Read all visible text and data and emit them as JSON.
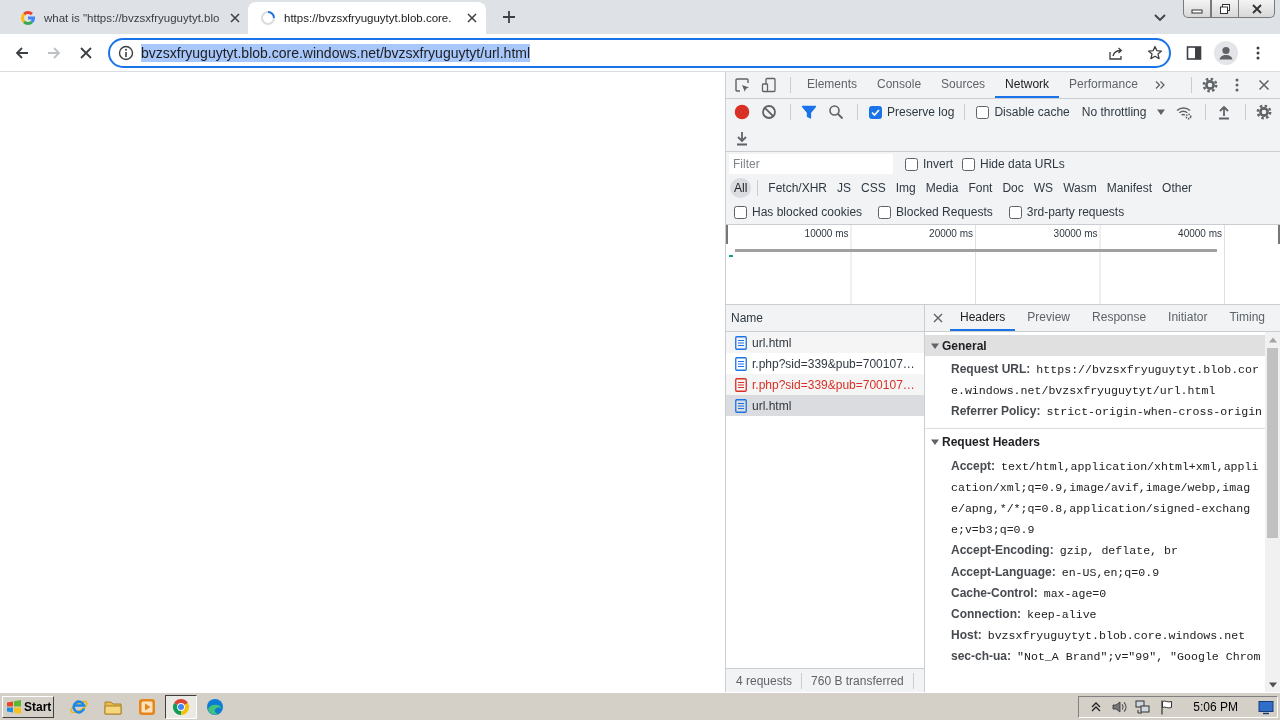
{
  "browser_tabs": [
    {
      "title": "what is \"https://bvzsxfryuguytyt.blo",
      "selected": false,
      "loading": false
    },
    {
      "title": "https://bvzsxfryuguytyt.blob.core.",
      "selected": true,
      "loading": true
    }
  ],
  "navigation": {
    "forward_enabled": false,
    "loading": true
  },
  "address_bar": {
    "url": "bvzsxfryuguytyt.blob.core.windows.net/bvzsxfryuguytyt/url.html",
    "highlighted": true
  },
  "devtools": {
    "tabs": [
      {
        "label": "Elements",
        "selected": false
      },
      {
        "label": "Console",
        "selected": false
      },
      {
        "label": "Sources",
        "selected": false
      },
      {
        "label": "Network",
        "selected": true
      },
      {
        "label": "Performance",
        "selected": false
      }
    ],
    "recording": true,
    "filter_active": true,
    "toolbar_checkboxes": [
      {
        "label": "Preserve log",
        "checked": true
      },
      {
        "label": "Disable cache",
        "checked": false
      }
    ],
    "throttling": "No throttling",
    "filter": {
      "placeholder": "Filter"
    },
    "filter_checkboxes": [
      {
        "label": "Invert",
        "checked": false
      },
      {
        "label": "Hide data URLs",
        "checked": false
      }
    ],
    "resource_types": [
      {
        "label": "All",
        "selected": true
      },
      {
        "label": "Fetch/XHR",
        "selected": false
      },
      {
        "label": "JS",
        "selected": false
      },
      {
        "label": "CSS",
        "selected": false
      },
      {
        "label": "Img",
        "selected": false
      },
      {
        "label": "Media",
        "selected": false
      },
      {
        "label": "Font",
        "selected": false
      },
      {
        "label": "Doc",
        "selected": false
      },
      {
        "label": "WS",
        "selected": false
      },
      {
        "label": "Wasm",
        "selected": false
      },
      {
        "label": "Manifest",
        "selected": false
      },
      {
        "label": "Other",
        "selected": false
      }
    ],
    "option_checkboxes": [
      {
        "label": "Has blocked cookies",
        "checked": false
      },
      {
        "label": "Blocked Requests",
        "checked": false
      },
      {
        "label": "3rd-party requests",
        "checked": false
      }
    ],
    "timeline_ticks": [
      "10000 ms",
      "20000 ms",
      "30000 ms",
      "40000 ms"
    ],
    "name_column": "Name",
    "requests": [
      {
        "name": "url.html",
        "selected": false,
        "failed": false
      },
      {
        "name": "r.php?sid=339&pub=700107…",
        "selected": false,
        "failed": false
      },
      {
        "name": "r.php?sid=339&pub=700107…",
        "selected": false,
        "failed": true
      },
      {
        "name": "url.html",
        "selected": true,
        "failed": false
      }
    ],
    "summary": [
      "4 requests",
      "760 B transferred"
    ],
    "detail_tabs": [
      {
        "label": "Headers",
        "selected": true
      },
      {
        "label": "Preview",
        "selected": false
      },
      {
        "label": "Response",
        "selected": false
      },
      {
        "label": "Initiator",
        "selected": false
      },
      {
        "label": "Timing",
        "selected": false
      }
    ],
    "sections": [
      {
        "title": "General",
        "expanded": true,
        "highlighted": true,
        "rows": [
          {
            "name": "Request URL:",
            "value": "https://bvzsxfryuguytyt.blob.core.windows.net/bvzsxfryuguytyt/url.html"
          },
          {
            "name": "Referrer Policy:",
            "value": "strict-origin-when-cross-origin"
          }
        ]
      },
      {
        "title": "Request Headers",
        "expanded": true,
        "highlighted": false,
        "rows": [
          {
            "name": "Accept:",
            "value": "text/html,application/xhtml+xml,application/xml;q=0.9,image/avif,image/webp,image/apng,*/*;q=0.8,application/signed-exchange;v=b3;q=0.9"
          },
          {
            "name": "Accept-Encoding:",
            "value": "gzip, deflate, br"
          },
          {
            "name": "Accept-Language:",
            "value": "en-US,en;q=0.9"
          },
          {
            "name": "Cache-Control:",
            "value": "max-age=0"
          },
          {
            "name": "Connection:",
            "value": "keep-alive"
          },
          {
            "name": "Host:",
            "value": "bvzsxfryuguytyt.blob.core.windows.net"
          },
          {
            "name": "sec-ch-ua:",
            "value": "\"Not_A Brand\";v=\"99\", \"Google Chrom"
          }
        ]
      }
    ]
  },
  "taskbar": {
    "start": "Start",
    "apps": [
      {
        "selected": false
      },
      {
        "selected": false
      },
      {
        "selected": false
      },
      {
        "selected": true
      },
      {
        "selected": false
      }
    ],
    "clock": "5:06 PM"
  }
}
